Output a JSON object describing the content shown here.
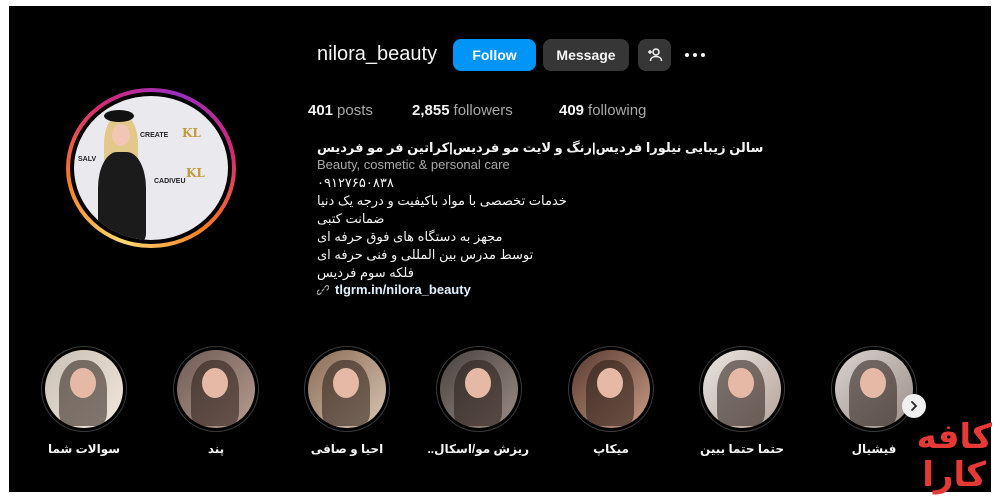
{
  "profile": {
    "username": "nilora_beauty",
    "follow_label": "Follow",
    "message_label": "Message",
    "add_user_icon": "person-plus-icon",
    "more_icon": "more-horizontal-icon"
  },
  "avatar": {
    "banner_texts": [
      "CREATE",
      "CADIVEU",
      "KL",
      "SALV"
    ]
  },
  "stats": [
    {
      "count": "401",
      "label": "posts"
    },
    {
      "count": "2,855",
      "label": "followers"
    },
    {
      "count": "409",
      "label": "following"
    }
  ],
  "bio": {
    "name": "سالن زیبایی نیلورا فردیس|رنگ و لایت مو فردیس|کراتین فر مو فردیس",
    "category": "Beauty, cosmetic & personal care",
    "lines": [
      "۰۹۱۲۷۶۵۰۸۳۸",
      "خدمات تخصصی با مواد باکیفیت و درجه یک دنیا",
      "ضمانت کتبی",
      "مجهز به دستگاه های فوق حرفه ای",
      "توسط مدرس بین المللی و فنی حرفه ای",
      "فلکه سوم فردیس"
    ],
    "link": "tlgrm.in/nilora_beauty",
    "link_icon": "link-icon"
  },
  "highlights": [
    {
      "label": "سوالات شما",
      "colors": [
        "#c9c0b5",
        "#f2e8dc"
      ]
    },
    {
      "label": "پند",
      "colors": [
        "#6e5c55",
        "#b79c90"
      ]
    },
    {
      "label": "احیا و صافی",
      "colors": [
        "#8a6b55",
        "#d9c6b3"
      ]
    },
    {
      "label": "ریزش مو/اسکال..",
      "colors": [
        "#4a4340",
        "#9a8c86"
      ]
    },
    {
      "label": "میکاپ",
      "colors": [
        "#5a3b32",
        "#c79b83"
      ]
    },
    {
      "label": "حتما حتما ببین",
      "colors": [
        "#e8e4e0",
        "#b5a49a"
      ]
    },
    {
      "label": "فیشیال",
      "colors": [
        "#d8d2cf",
        "#9c8f8a"
      ]
    }
  ],
  "next_icon": "chevron-right-icon",
  "watermark": {
    "line1": "کافه",
    "line2": "کارا",
    "color": "#e53935"
  }
}
